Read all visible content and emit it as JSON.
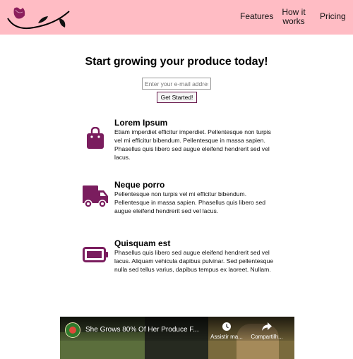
{
  "header": {
    "bg_color": "#ffbcc4",
    "logo_icon": "rose-vine-logo",
    "nav": [
      {
        "label": "Features"
      },
      {
        "label": "How it works"
      },
      {
        "label": "Pricing"
      }
    ]
  },
  "hero": {
    "title": "Start growing your produce today!",
    "email_placeholder": "Enter your e-mail address",
    "button_label": "Get Started!"
  },
  "features": [
    {
      "icon": "shopping-bag-icon",
      "title": "Lorem Ipsum",
      "text": "Etiam imperdiet efficitur imperdiet. Pellentesque non turpis vel mi efficitur bibendum. Pellentesque in massa sapien. Phasellus quis libero sed augue eleifend hendrerit sed vel lacus."
    },
    {
      "icon": "truck-icon",
      "title": "Neque porro",
      "text": "Pellentesque non turpis vel mi efficitur bibendum. Pellentesque in massa sapien. Phasellus quis libero sed augue eleifend hendrerit sed vel lacus."
    },
    {
      "icon": "battery-icon",
      "title": "Quisquam est",
      "text": "Phasellus quis libero sed augue eleifend hendrerit sed vel lacus. Aliquam vehicula dapibus pulvinar. Sed pellentesque nulla sed tellus varius, dapibus tempus ex laoreet. Nullam."
    }
  ],
  "icon_color": "#7a1d5e",
  "video": {
    "title": "She Grows 80% Of Her Produce F...",
    "watch_later_label": "Assistir ma...",
    "share_label": "Compartilh..."
  }
}
